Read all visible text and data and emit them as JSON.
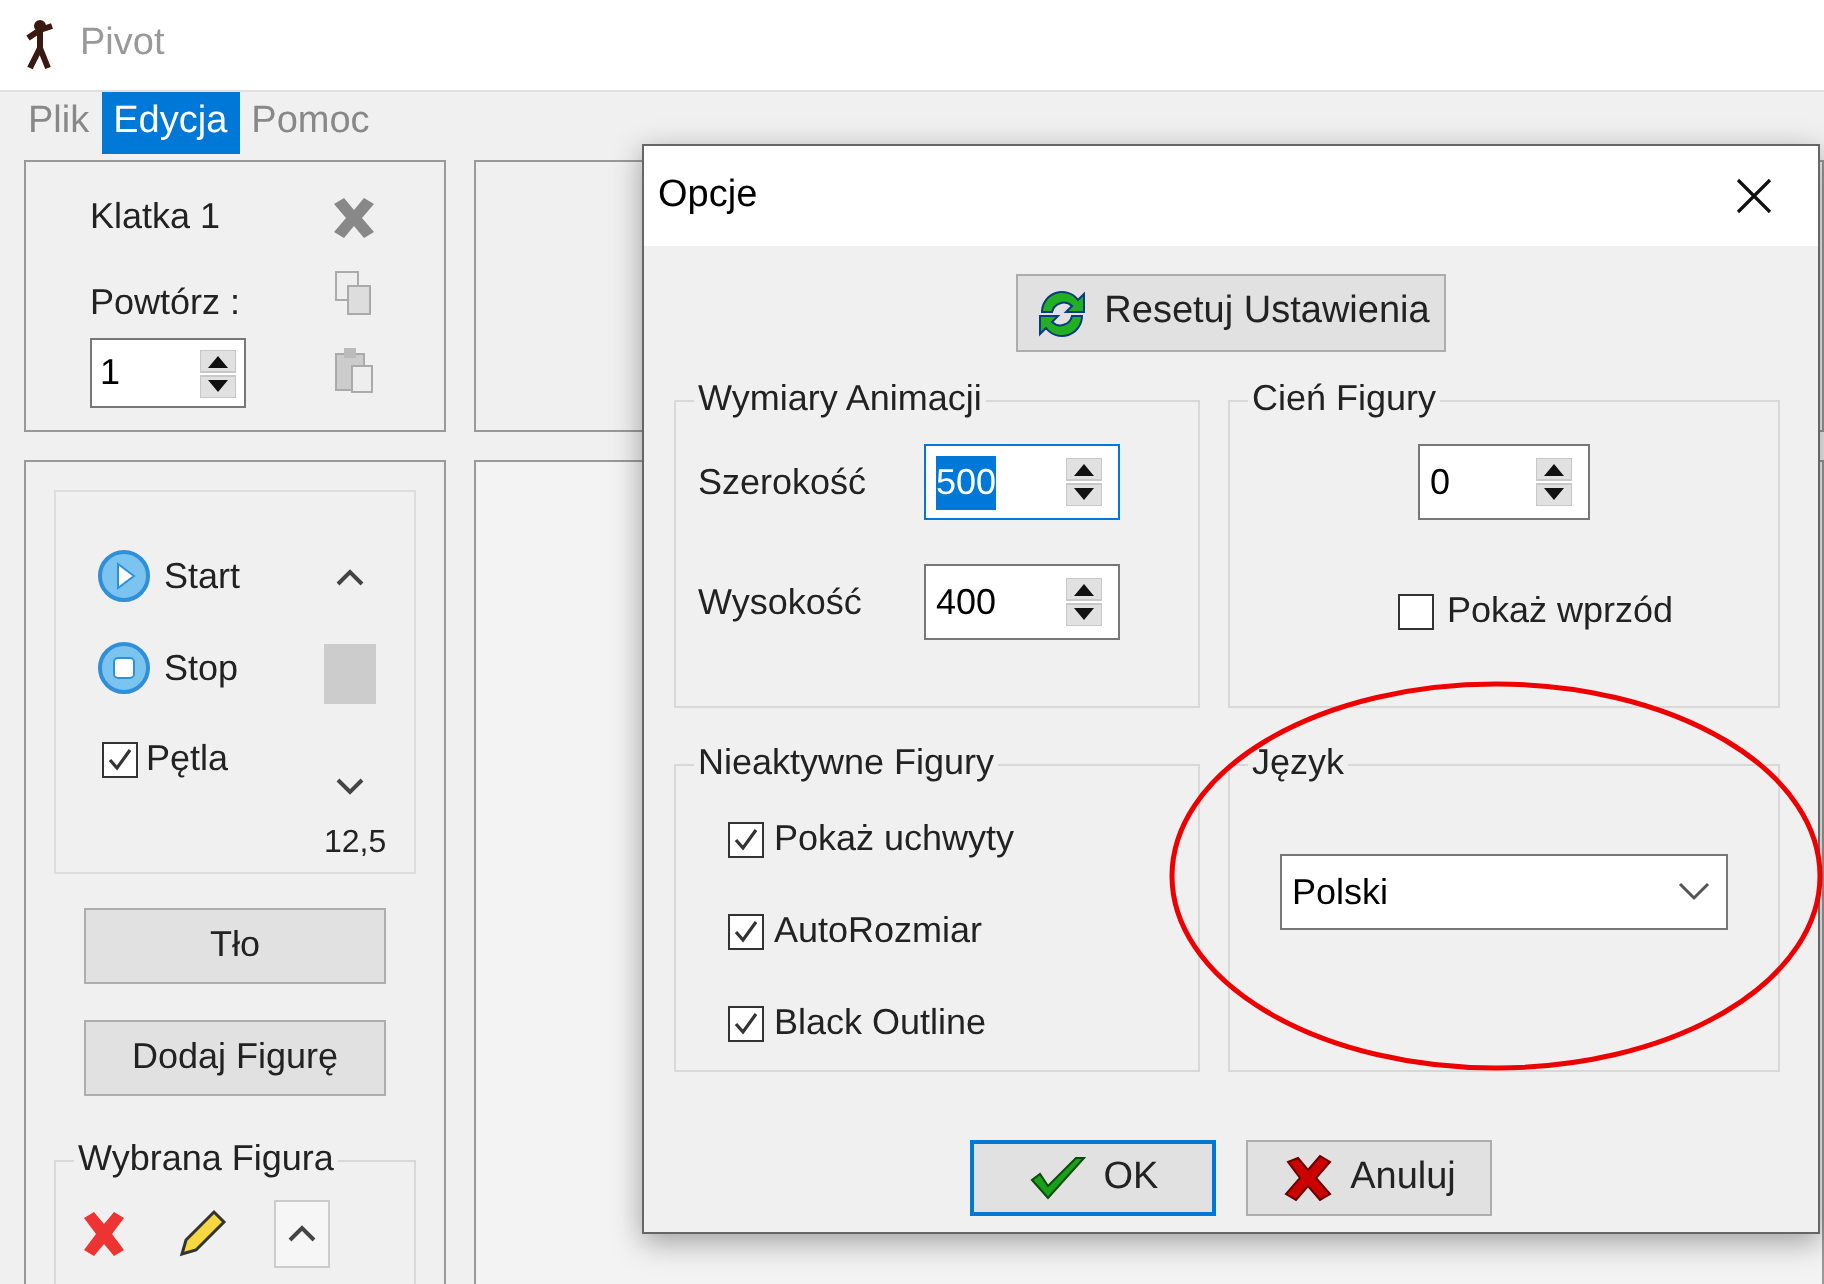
{
  "window": {
    "title": "Pivot"
  },
  "menu": [
    {
      "label": "Plik",
      "selected": false
    },
    {
      "label": "Edycja",
      "selected": true
    },
    {
      "label": "Pomoc",
      "selected": false
    }
  ],
  "frame_panel": {
    "frame_label": "Klatka 1",
    "repeat_label": "Powtórz :",
    "repeat_value": "1"
  },
  "playback": {
    "buttons": [
      {
        "label": "Start",
        "kind": "play"
      },
      {
        "label": "Stop",
        "kind": "stop"
      }
    ],
    "loop": {
      "label": "Pętla",
      "checked": true
    },
    "speed": "12,5"
  },
  "side_buttons": [
    "Tło",
    "Dodaj Figurę"
  ],
  "selected_figure": {
    "title": "Wybrana Figura"
  },
  "dialog": {
    "title": "Opcje",
    "reset_button": "Resetuj Ustawienia",
    "dimensions": {
      "title": "Wymiary Animacji",
      "fields": [
        {
          "label": "Szerokość",
          "value": "500",
          "selected": true
        },
        {
          "label": "Wysokość",
          "value": "400",
          "selected": false
        }
      ]
    },
    "shadow": {
      "title": "Cień Figury",
      "value": "0",
      "front": {
        "label": "Pokaż wprzód",
        "checked": false
      }
    },
    "inactive": {
      "title": "Nieaktywne Figury",
      "options": [
        {
          "label": "Pokaż uchwyty",
          "checked": true
        },
        {
          "label": "AutoRozmiar",
          "checked": true
        },
        {
          "label": "Black Outline",
          "checked": true
        }
      ]
    },
    "language": {
      "title": "Język",
      "value": "Polski"
    },
    "buttons": [
      {
        "label": "OK",
        "kind": "ok",
        "selected": true
      },
      {
        "label": "Anuluj",
        "kind": "cancel",
        "selected": false
      }
    ]
  }
}
